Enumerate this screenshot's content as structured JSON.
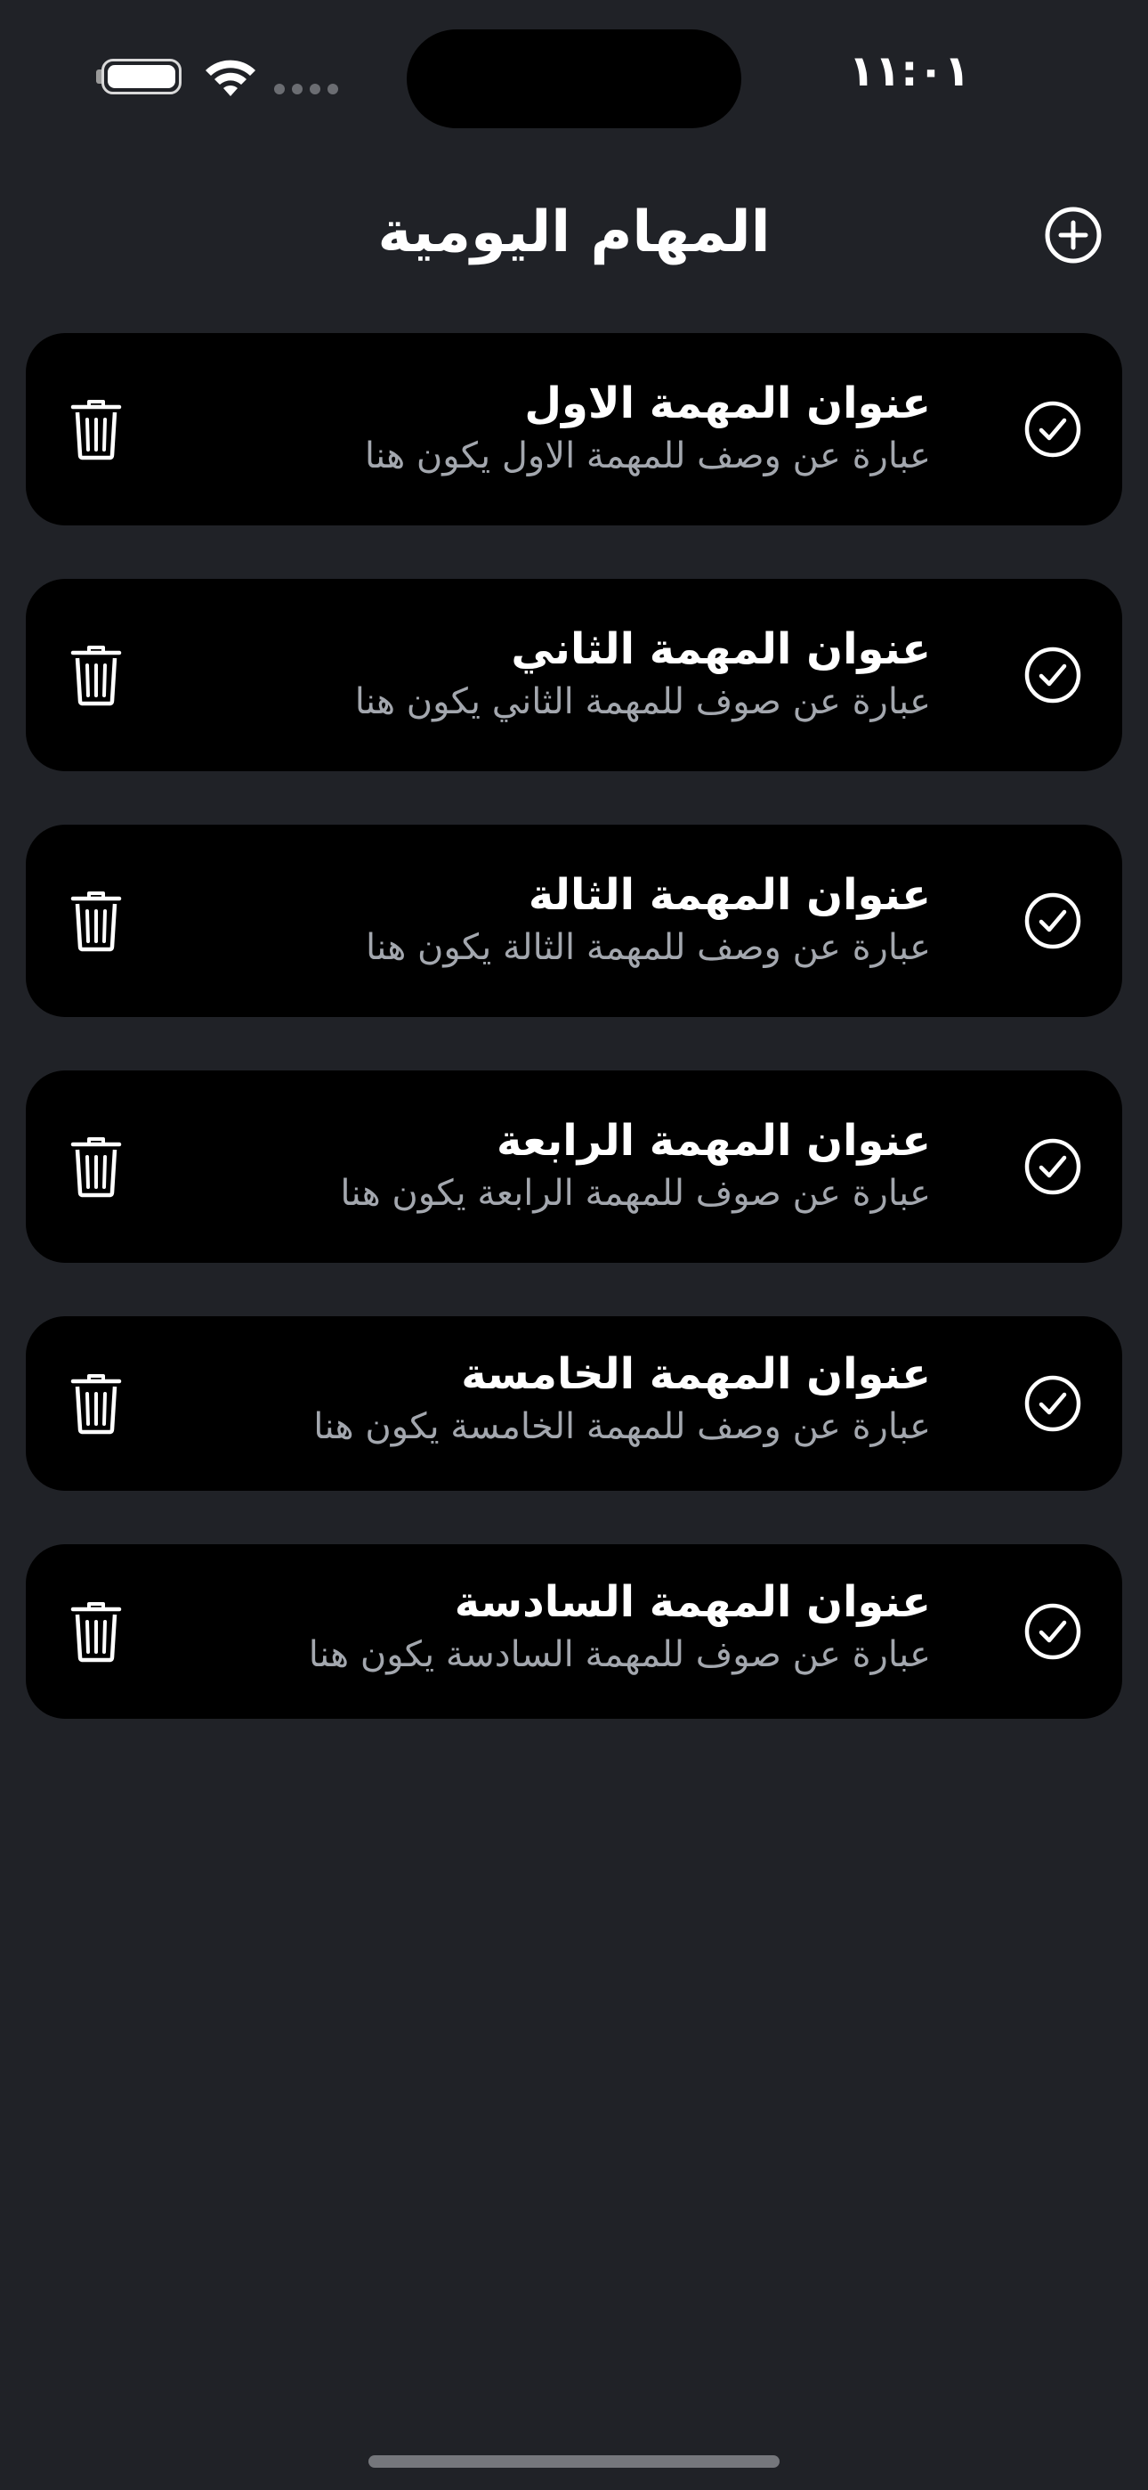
{
  "status_bar": {
    "time": "١١:٠١",
    "icons": [
      "battery-icon",
      "wifi-icon",
      "signal-icon"
    ]
  },
  "header": {
    "title": "المهام اليومية",
    "add_icon": "plus-circle-icon"
  },
  "tasks": [
    {
      "title": "عنوان المهمة الاول",
      "description": "عبارة عن وصف للمهمة الاول يكون هنا"
    },
    {
      "title": "عنوان المهمة الثاني",
      "description": "عبارة عن صوف للمهمة الثاني يكون هنا"
    },
    {
      "title": "عنوان المهمة الثالة",
      "description": "عبارة عن وصف للمهمة الثالة يكون هنا"
    },
    {
      "title": "عنوان المهمة الرابعة",
      "description": "عبارة عن صوف للمهمة الرابعة يكون هنا"
    },
    {
      "title": "عنوان المهمة الخامسة",
      "description": "عبارة عن وصف للمهمة الخامسة يكون هنا"
    },
    {
      "title": "عنوان المهمة السادسة",
      "description": "عبارة عن صوف للمهمة السادسة يكون هنا"
    }
  ],
  "task_icons": {
    "complete": "check-circle-icon",
    "delete": "trash-icon"
  },
  "colors": {
    "background": "#202227",
    "card": "#000000",
    "title_text": "#ffffff",
    "description_text": "#a3a7ae"
  }
}
